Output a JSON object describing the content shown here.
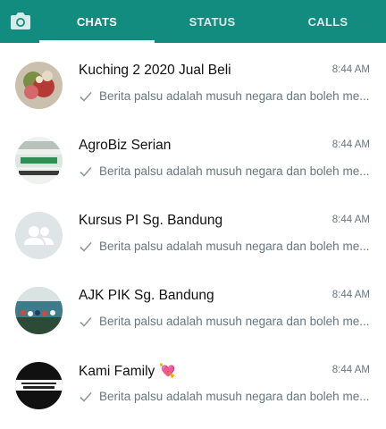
{
  "header": {
    "camera_icon": "camera-icon",
    "tabs": [
      {
        "label": "CHATS",
        "active": true
      },
      {
        "label": "STATUS",
        "active": false
      },
      {
        "label": "CALLS",
        "active": false
      }
    ],
    "accent_color": "#128c7e"
  },
  "chats": [
    {
      "name": "Kuching 2 2020 Jual Beli",
      "time": "8:44 AM",
      "preview": "Berita palsu adalah musuh negara dan boleh me...",
      "avatar": "flowers-photo"
    },
    {
      "name": "AgroBiz Serian",
      "time": "8:44 AM",
      "preview": "Berita palsu adalah musuh negara dan boleh me...",
      "avatar": "agrobiz-logo"
    },
    {
      "name": "Kursus PI Sg. Bandung",
      "time": "8:44 AM",
      "preview": "Berita palsu adalah musuh negara dan boleh me...",
      "avatar": "default-group-icon"
    },
    {
      "name": "AJK PIK Sg. Bandung",
      "time": "8:44 AM",
      "preview": "Berita palsu adalah musuh negara dan boleh me...",
      "avatar": "group-photo"
    },
    {
      "name": "Kami Family 💘",
      "time": "8:44 AM",
      "preview": "Berita palsu adalah musuh negara dan boleh me...",
      "avatar": "happy-family-logo"
    }
  ]
}
